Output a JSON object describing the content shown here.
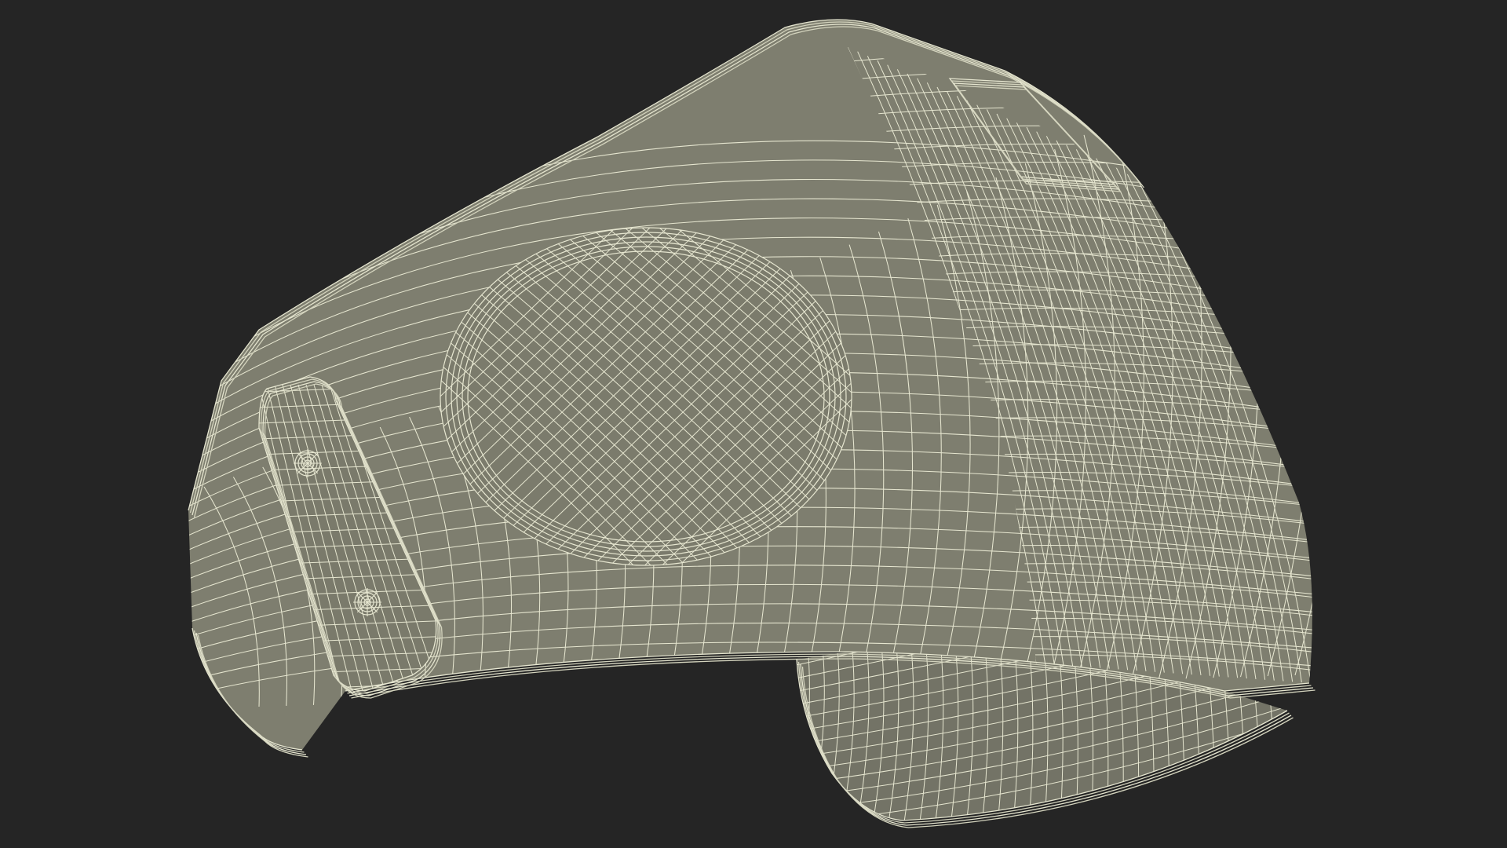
{
  "scene": {
    "subject": "wireframe-mesh",
    "colors": {
      "background": "#252525",
      "surface": "#7e7e6f",
      "surface_shadow": "#6f6f62",
      "surface_inner": "#737366",
      "wire": "#e6e6d0",
      "wire_soft": "#d3d3bd"
    }
  }
}
